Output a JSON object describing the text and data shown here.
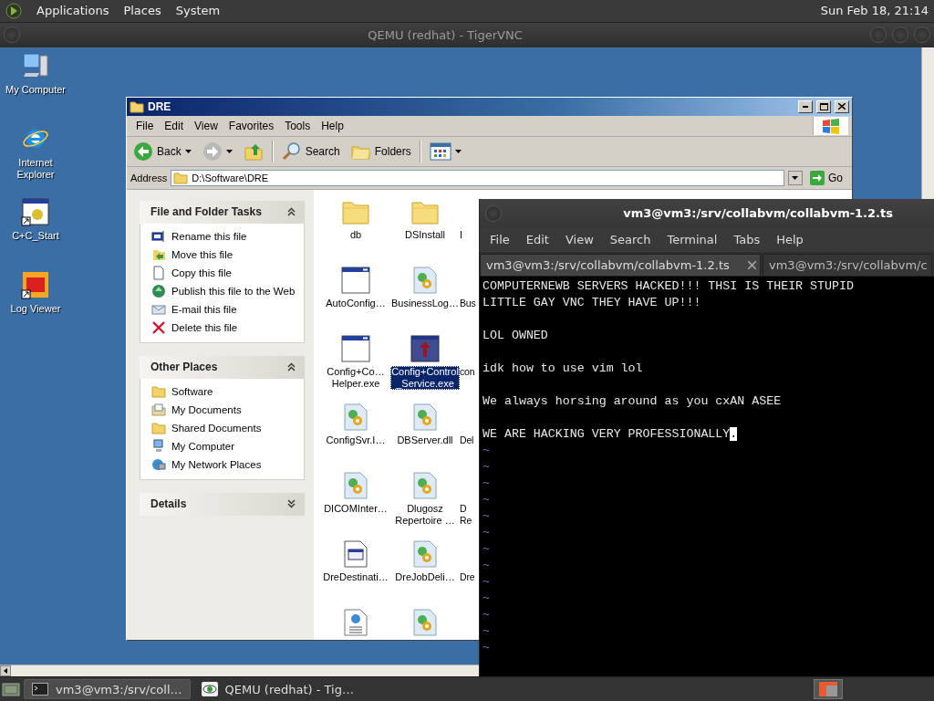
{
  "top_panel": {
    "menus": [
      "Applications",
      "Places",
      "System"
    ],
    "clock": "Sun Feb 18, 21:14"
  },
  "viewer_window": {
    "title": "QEMU (redhat) - TigerVNC"
  },
  "desktop_icons": [
    {
      "label": "My Computer",
      "kind": "computer"
    },
    {
      "label": "Internet Explorer",
      "kind": "browser"
    },
    {
      "label": "C+C_Start",
      "kind": "app-shortcut"
    },
    {
      "label": "Log Viewer",
      "kind": "viewer-shortcut"
    }
  ],
  "explorer": {
    "title": "DRE",
    "menu": [
      "File",
      "Edit",
      "View",
      "Favorites",
      "Tools",
      "Help"
    ],
    "toolbar": [
      {
        "kind": "back",
        "label": "Back"
      },
      {
        "kind": "forward"
      },
      {
        "kind": "up"
      },
      {
        "kind": "search",
        "label": "Search"
      },
      {
        "kind": "folders",
        "label": "Folders"
      },
      {
        "kind": "views"
      }
    ],
    "address": {
      "label": "Address",
      "value": "D:\\Software\\DRE",
      "go": "Go"
    },
    "task_panels": [
      {
        "title": "File and Folder Tasks",
        "expanded": true,
        "items": [
          {
            "label": "Rename this file",
            "kind": "rename"
          },
          {
            "label": "Move this file",
            "kind": "move"
          },
          {
            "label": "Copy this file",
            "kind": "copy"
          },
          {
            "label": "Publish this file to the Web",
            "kind": "publish"
          },
          {
            "label": "E-mail this file",
            "kind": "email"
          },
          {
            "label": "Delete this file",
            "kind": "delete"
          }
        ]
      },
      {
        "title": "Other Places",
        "expanded": true,
        "items": [
          {
            "label": "Software",
            "kind": "folder"
          },
          {
            "label": "My Documents",
            "kind": "documents"
          },
          {
            "label": "Shared Documents",
            "kind": "folder"
          },
          {
            "label": "My Computer",
            "kind": "computer"
          },
          {
            "label": "My Network Places",
            "kind": "network"
          }
        ]
      },
      {
        "title": "Details",
        "expanded": false
      }
    ],
    "files": [
      {
        "label": "db",
        "kind": "folder",
        "selected": false
      },
      {
        "label": "DSInstall",
        "kind": "folder",
        "selected": false
      },
      {
        "label": "I",
        "kind": "hidden",
        "selected": false
      },
      {
        "label": "AutoConfig…",
        "kind": "app",
        "selected": false
      },
      {
        "label": "BusinessLog…",
        "kind": "dll",
        "selected": false
      },
      {
        "label": "Bus",
        "kind": "hidden",
        "selected": false
      },
      {
        "label": "Config+Co… Helper.exe",
        "kind": "app",
        "selected": false
      },
      {
        "label": "Config+Control_Service.exe",
        "kind": "service",
        "selected": true
      },
      {
        "label": "con",
        "kind": "hidden",
        "selected": false
      },
      {
        "label": "ConfigSvr.I…",
        "kind": "dll",
        "selected": false
      },
      {
        "label": "DBServer.dll",
        "kind": "dll",
        "selected": false
      },
      {
        "label": "Del",
        "kind": "hidden",
        "selected": false
      },
      {
        "label": "DICOMInter…",
        "kind": "dll",
        "selected": false
      },
      {
        "label": "Dlugosz Repertoire …",
        "kind": "dll",
        "selected": false
      },
      {
        "label": "D\nRe",
        "kind": "hidden",
        "selected": false
      },
      {
        "label": "DreDestinati…",
        "kind": "doc-app",
        "selected": false
      },
      {
        "label": "DreJobDeli…",
        "kind": "dll",
        "selected": false
      },
      {
        "label": "Dre",
        "kind": "hidden",
        "selected": false
      },
      {
        "kind": "web-doc",
        "selected": false
      },
      {
        "kind": "dll",
        "selected": false
      }
    ]
  },
  "terminal": {
    "title": "vm3@vm3:/srv/collabvm/collabvm-1.2.ts",
    "menu": [
      "File",
      "Edit",
      "View",
      "Search",
      "Terminal",
      "Tabs",
      "Help"
    ],
    "tabs": [
      {
        "label": "vm3@vm3:/srv/collabvm/collabvm-1.2.ts",
        "selected": true
      },
      {
        "label": "vm3@vm3:/srv/collabvm/c",
        "selected": false
      }
    ],
    "lines": [
      {
        "kind": "text",
        "text": "COMPUTERNEWB SERVERS HACKED!!! THSI IS THEIR STUPID"
      },
      {
        "kind": "text",
        "text": "LITTLE GAY VNC THEY HAVE UP!!!"
      },
      {
        "kind": "empty"
      },
      {
        "kind": "text",
        "text": "LOL OWNED"
      },
      {
        "kind": "empty"
      },
      {
        "kind": "text",
        "text": "idk how to use vim lol"
      },
      {
        "kind": "empty"
      },
      {
        "kind": "text",
        "text": "We always horsing around as you cxAN ASEE"
      },
      {
        "kind": "empty"
      },
      {
        "kind": "text",
        "text": "WE ARE HACKING VERY PROFESSIONALLY",
        "cursor": "."
      },
      {
        "kind": "filler",
        "text": "~"
      },
      {
        "kind": "filler",
        "text": "~"
      },
      {
        "kind": "filler",
        "text": "~"
      },
      {
        "kind": "filler",
        "text": "~"
      },
      {
        "kind": "filler",
        "text": "~"
      },
      {
        "kind": "filler",
        "text": "~"
      },
      {
        "kind": "filler",
        "text": "~"
      },
      {
        "kind": "filler",
        "text": "~"
      },
      {
        "kind": "filler",
        "text": "~"
      },
      {
        "kind": "filler",
        "text": "~"
      },
      {
        "kind": "filler",
        "text": "~"
      },
      {
        "kind": "filler",
        "text": "~"
      },
      {
        "kind": "filler",
        "text": "~"
      }
    ]
  },
  "taskbar": {
    "items": [
      {
        "label": "vm3@vm3:/srv/coll…",
        "kind": "terminal",
        "selected": true
      },
      {
        "label": "QEMU (redhat) - Tig…",
        "kind": "viewer",
        "selected": false
      }
    ]
  }
}
